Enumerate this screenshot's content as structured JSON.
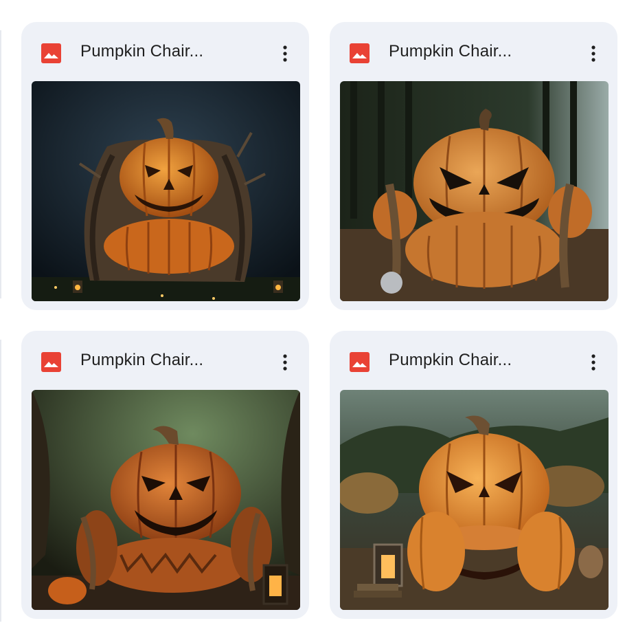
{
  "files": [
    {
      "name": "Pumpkin Chair...",
      "file_type_icon": "image-icon",
      "menu_icon": "more-vert-icon",
      "scene": "night-tree-throne"
    },
    {
      "name": "Pumpkin Chair...",
      "file_type_icon": "image-icon",
      "menu_icon": "more-vert-icon",
      "scene": "forest-angry-sofa"
    },
    {
      "name": "Pumpkin Chair...",
      "file_type_icon": "image-icon",
      "menu_icon": "more-vert-icon",
      "scene": "woods-grin-armchair"
    },
    {
      "name": "Pumpkin Chair...",
      "file_type_icon": "image-icon",
      "menu_icon": "more-vert-icon",
      "scene": "haybale-field-armchair"
    }
  ],
  "colors": {
    "card_bg": "#eef1f7",
    "image_icon": "#e94235",
    "title_text": "#1f1f1f",
    "pumpkin": "#d87a25"
  }
}
